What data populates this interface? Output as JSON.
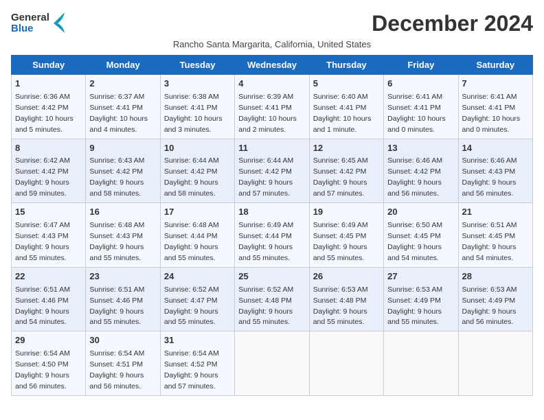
{
  "logo": {
    "line1": "General",
    "line2": "Blue"
  },
  "title": "December 2024",
  "subtitle": "Rancho Santa Margarita, California, United States",
  "days_of_week": [
    "Sunday",
    "Monday",
    "Tuesday",
    "Wednesday",
    "Thursday",
    "Friday",
    "Saturday"
  ],
  "weeks": [
    [
      {
        "day": 1,
        "sunrise": "6:36 AM",
        "sunset": "4:42 PM",
        "daylight": "10 hours and 5 minutes."
      },
      {
        "day": 2,
        "sunrise": "6:37 AM",
        "sunset": "4:41 PM",
        "daylight": "10 hours and 4 minutes."
      },
      {
        "day": 3,
        "sunrise": "6:38 AM",
        "sunset": "4:41 PM",
        "daylight": "10 hours and 3 minutes."
      },
      {
        "day": 4,
        "sunrise": "6:39 AM",
        "sunset": "4:41 PM",
        "daylight": "10 hours and 2 minutes."
      },
      {
        "day": 5,
        "sunrise": "6:40 AM",
        "sunset": "4:41 PM",
        "daylight": "10 hours and 1 minute."
      },
      {
        "day": 6,
        "sunrise": "6:41 AM",
        "sunset": "4:41 PM",
        "daylight": "10 hours and 0 minutes."
      },
      {
        "day": 7,
        "sunrise": "6:41 AM",
        "sunset": "4:41 PM",
        "daylight": "10 hours and 0 minutes."
      }
    ],
    [
      {
        "day": 8,
        "sunrise": "6:42 AM",
        "sunset": "4:42 PM",
        "daylight": "9 hours and 59 minutes."
      },
      {
        "day": 9,
        "sunrise": "6:43 AM",
        "sunset": "4:42 PM",
        "daylight": "9 hours and 58 minutes."
      },
      {
        "day": 10,
        "sunrise": "6:44 AM",
        "sunset": "4:42 PM",
        "daylight": "9 hours and 58 minutes."
      },
      {
        "day": 11,
        "sunrise": "6:44 AM",
        "sunset": "4:42 PM",
        "daylight": "9 hours and 57 minutes."
      },
      {
        "day": 12,
        "sunrise": "6:45 AM",
        "sunset": "4:42 PM",
        "daylight": "9 hours and 57 minutes."
      },
      {
        "day": 13,
        "sunrise": "6:46 AM",
        "sunset": "4:42 PM",
        "daylight": "9 hours and 56 minutes."
      },
      {
        "day": 14,
        "sunrise": "6:46 AM",
        "sunset": "4:43 PM",
        "daylight": "9 hours and 56 minutes."
      }
    ],
    [
      {
        "day": 15,
        "sunrise": "6:47 AM",
        "sunset": "4:43 PM",
        "daylight": "9 hours and 55 minutes."
      },
      {
        "day": 16,
        "sunrise": "6:48 AM",
        "sunset": "4:43 PM",
        "daylight": "9 hours and 55 minutes."
      },
      {
        "day": 17,
        "sunrise": "6:48 AM",
        "sunset": "4:44 PM",
        "daylight": "9 hours and 55 minutes."
      },
      {
        "day": 18,
        "sunrise": "6:49 AM",
        "sunset": "4:44 PM",
        "daylight": "9 hours and 55 minutes."
      },
      {
        "day": 19,
        "sunrise": "6:49 AM",
        "sunset": "4:45 PM",
        "daylight": "9 hours and 55 minutes."
      },
      {
        "day": 20,
        "sunrise": "6:50 AM",
        "sunset": "4:45 PM",
        "daylight": "9 hours and 54 minutes."
      },
      {
        "day": 21,
        "sunrise": "6:51 AM",
        "sunset": "4:45 PM",
        "daylight": "9 hours and 54 minutes."
      }
    ],
    [
      {
        "day": 22,
        "sunrise": "6:51 AM",
        "sunset": "4:46 PM",
        "daylight": "9 hours and 54 minutes."
      },
      {
        "day": 23,
        "sunrise": "6:51 AM",
        "sunset": "4:46 PM",
        "daylight": "9 hours and 55 minutes."
      },
      {
        "day": 24,
        "sunrise": "6:52 AM",
        "sunset": "4:47 PM",
        "daylight": "9 hours and 55 minutes."
      },
      {
        "day": 25,
        "sunrise": "6:52 AM",
        "sunset": "4:48 PM",
        "daylight": "9 hours and 55 minutes."
      },
      {
        "day": 26,
        "sunrise": "6:53 AM",
        "sunset": "4:48 PM",
        "daylight": "9 hours and 55 minutes."
      },
      {
        "day": 27,
        "sunrise": "6:53 AM",
        "sunset": "4:49 PM",
        "daylight": "9 hours and 55 minutes."
      },
      {
        "day": 28,
        "sunrise": "6:53 AM",
        "sunset": "4:49 PM",
        "daylight": "9 hours and 56 minutes."
      }
    ],
    [
      {
        "day": 29,
        "sunrise": "6:54 AM",
        "sunset": "4:50 PM",
        "daylight": "9 hours and 56 minutes."
      },
      {
        "day": 30,
        "sunrise": "6:54 AM",
        "sunset": "4:51 PM",
        "daylight": "9 hours and 56 minutes."
      },
      {
        "day": 31,
        "sunrise": "6:54 AM",
        "sunset": "4:52 PM",
        "daylight": "9 hours and 57 minutes."
      },
      null,
      null,
      null,
      null
    ]
  ]
}
